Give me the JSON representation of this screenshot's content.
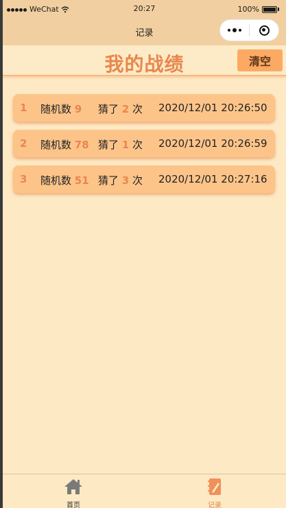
{
  "status_bar": {
    "carrier": "WeChat",
    "time": "20:27",
    "battery": "100%"
  },
  "navbar": {
    "title": "记录"
  },
  "header": {
    "title": "我的战绩",
    "clear_label": "清空"
  },
  "labels": {
    "random_number": "随机数",
    "guessed": "猜了",
    "times": "次"
  },
  "records": [
    {
      "index": "1",
      "number": "9",
      "guesses": "2",
      "timestamp": "2020/12/01 20:26:50"
    },
    {
      "index": "2",
      "number": "78",
      "guesses": "1",
      "timestamp": "2020/12/01 20:26:59"
    },
    {
      "index": "3",
      "number": "51",
      "guesses": "3",
      "timestamp": "2020/12/01 20:27:16"
    }
  ],
  "tabbar": {
    "items": [
      {
        "label": "首页",
        "icon": "home-icon",
        "active": false
      },
      {
        "label": "记录",
        "icon": "notebook-icon",
        "active": true
      }
    ]
  },
  "colors": {
    "accent": "#e8874d",
    "card": "#fdc48a",
    "background": "#fde9c3",
    "navbar": "#f1cfa0",
    "button": "#fca963"
  }
}
